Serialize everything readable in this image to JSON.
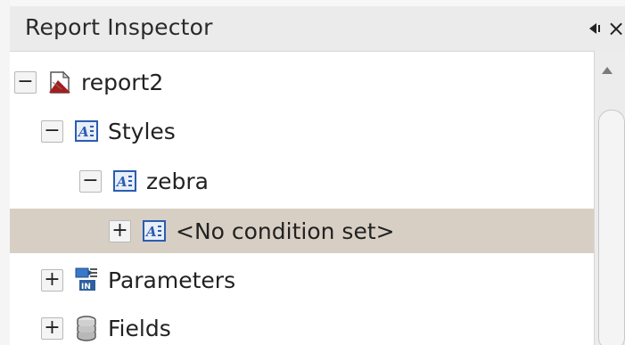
{
  "window": {
    "title": "Report Inspector",
    "minimize_icon": "dock-arrow-icon",
    "close_label": "×"
  },
  "tree": {
    "nodes": [
      {
        "label": "report2",
        "expander": "−",
        "icon": "report-icon",
        "expanded": true,
        "selected": false
      },
      {
        "label": "Styles",
        "expander": "−",
        "icon": "style-icon",
        "expanded": true,
        "selected": false
      },
      {
        "label": "zebra",
        "expander": "−",
        "icon": "style-icon",
        "expanded": true,
        "selected": false
      },
      {
        "label": "<No condition set>",
        "expander": "+",
        "icon": "style-icon",
        "expanded": false,
        "selected": true
      },
      {
        "label": "Parameters",
        "expander": "+",
        "icon": "parameters-icon",
        "expanded": false,
        "selected": false
      },
      {
        "label": "Fields",
        "expander": "+",
        "icon": "fields-icon",
        "expanded": false,
        "selected": false
      }
    ]
  },
  "colors": {
    "selection": "#d8cfc4",
    "style_icon_blue": "#2a5db0",
    "report_icon_red": "#a61d1d"
  }
}
